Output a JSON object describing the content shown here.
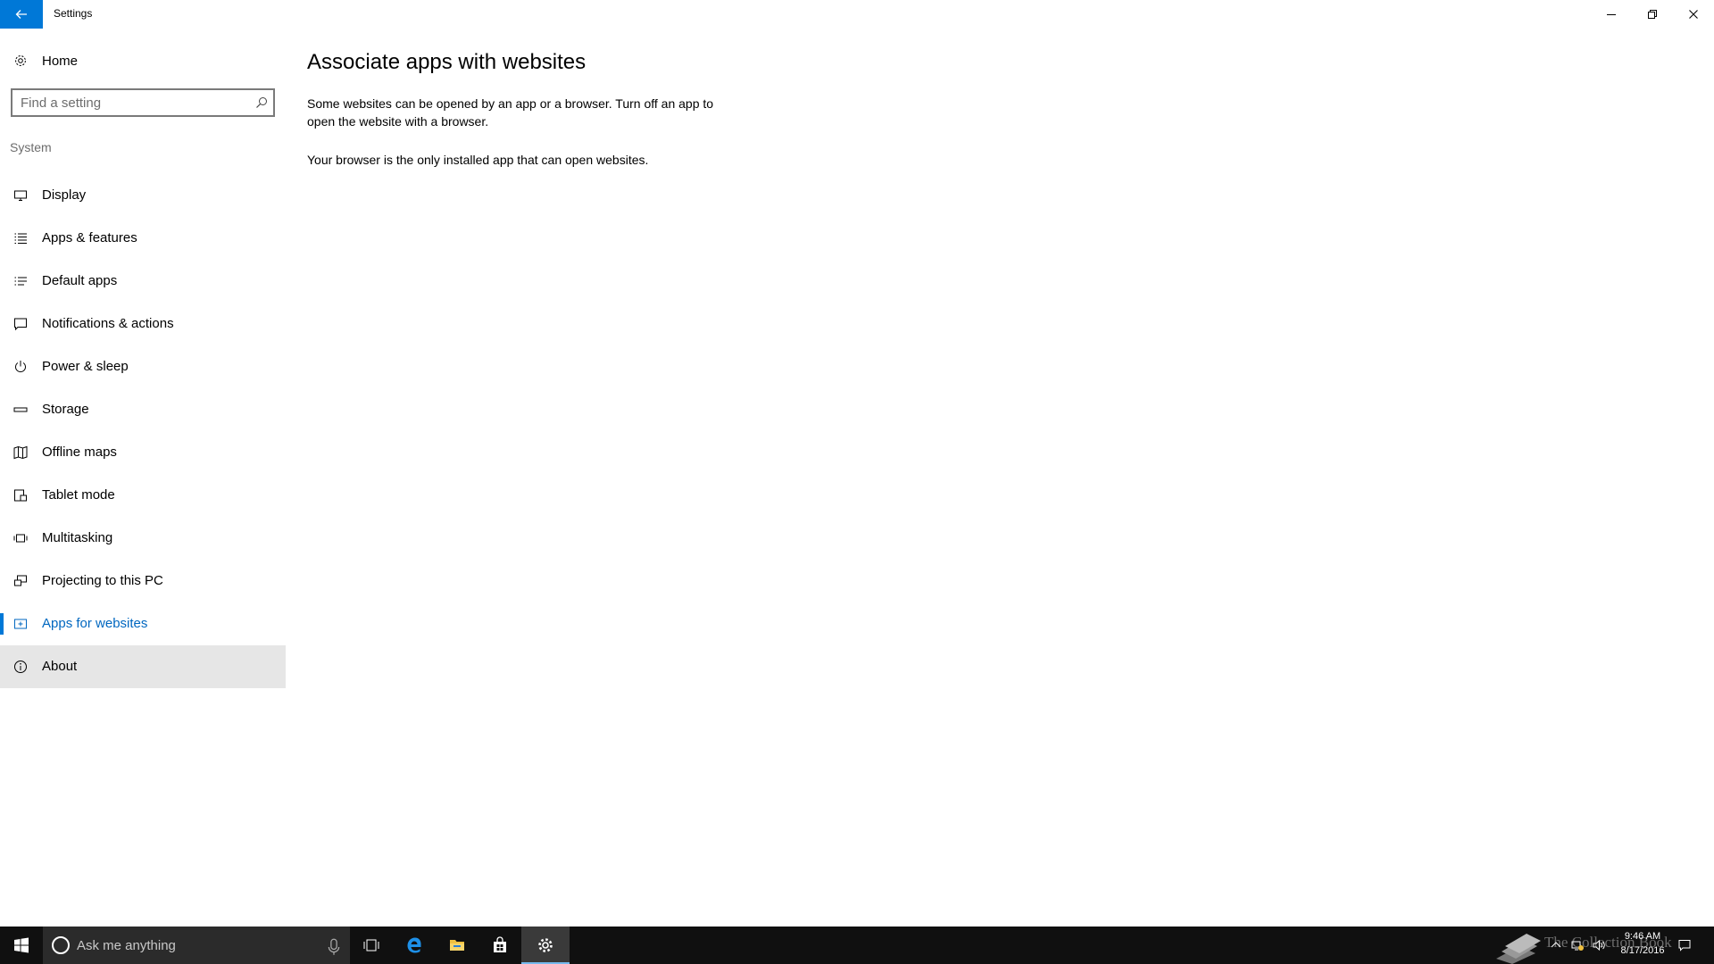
{
  "window": {
    "title": "Settings",
    "controls": [
      "minimize",
      "maximize",
      "close"
    ]
  },
  "sidebar": {
    "home_label": "Home",
    "search_placeholder": "Find a setting",
    "section_label": "System",
    "items": [
      {
        "label": "Display",
        "icon": "display-icon"
      },
      {
        "label": "Apps & features",
        "icon": "list-icon"
      },
      {
        "label": "Default apps",
        "icon": "list-icon"
      },
      {
        "label": "Notifications & actions",
        "icon": "message-icon"
      },
      {
        "label": "Power & sleep",
        "icon": "power-icon"
      },
      {
        "label": "Storage",
        "icon": "storage-icon"
      },
      {
        "label": "Offline maps",
        "icon": "map-icon"
      },
      {
        "label": "Tablet mode",
        "icon": "tablet-icon"
      },
      {
        "label": "Multitasking",
        "icon": "multitask-icon"
      },
      {
        "label": "Projecting to this PC",
        "icon": "projector-icon"
      },
      {
        "label": "Apps for websites",
        "icon": "website-icon",
        "selected": true
      },
      {
        "label": "About",
        "icon": "info-icon",
        "hovered": true
      }
    ]
  },
  "main": {
    "title": "Associate apps with websites",
    "description": "Some websites can be opened by an app or a browser.  Turn off an app to open the website with a browser.",
    "info": "Your browser is the only installed app that can open websites."
  },
  "taskbar": {
    "search_placeholder": "Ask me anything",
    "pinned": [
      "task-view-icon",
      "edge-icon",
      "file-explorer-icon",
      "store-icon",
      "settings-icon"
    ],
    "clock_time": "9:46 AM",
    "clock_date": "8/17/2016",
    "watermark": "The Collection Book"
  },
  "colors": {
    "accent": "#0078d7",
    "selected_text": "#0067c0",
    "hover_bg": "#e6e6e6",
    "taskbar_bg": "#101010"
  }
}
